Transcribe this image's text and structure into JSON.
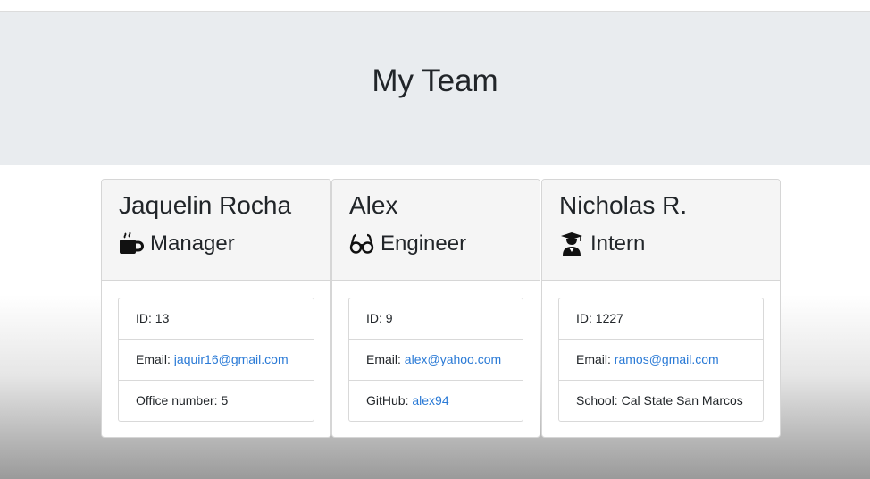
{
  "page": {
    "title": "My Team"
  },
  "team": [
    {
      "name": "Jaquelin Rocha",
      "role": "Manager",
      "role_icon": "mug-icon",
      "id_label": "ID:",
      "id": "13",
      "email_label": "Email:",
      "email": "jaquir16@gmail.com",
      "extra_label": "Office number:",
      "extra_value": "5"
    },
    {
      "name": "Alex",
      "role": "Engineer",
      "role_icon": "glasses-icon",
      "id_label": "ID:",
      "id": "9",
      "email_label": "Email:",
      "email": "alex@yahoo.com",
      "extra_label": "GitHub:",
      "extra_value": "alex94"
    },
    {
      "name": "Nicholas R.",
      "role": "Intern",
      "role_icon": "graduate-icon",
      "id_label": "ID:",
      "id": "1227",
      "email_label": "Email:",
      "email": "ramos@gmail.com",
      "extra_label": "School:",
      "extra_value": "Cal State San Marcos"
    }
  ],
  "colors": {
    "jumbotron_bg": "#e9ecef",
    "card_header_bg": "#f5f5f5",
    "link": "#2a7ad6",
    "text": "#212529"
  }
}
